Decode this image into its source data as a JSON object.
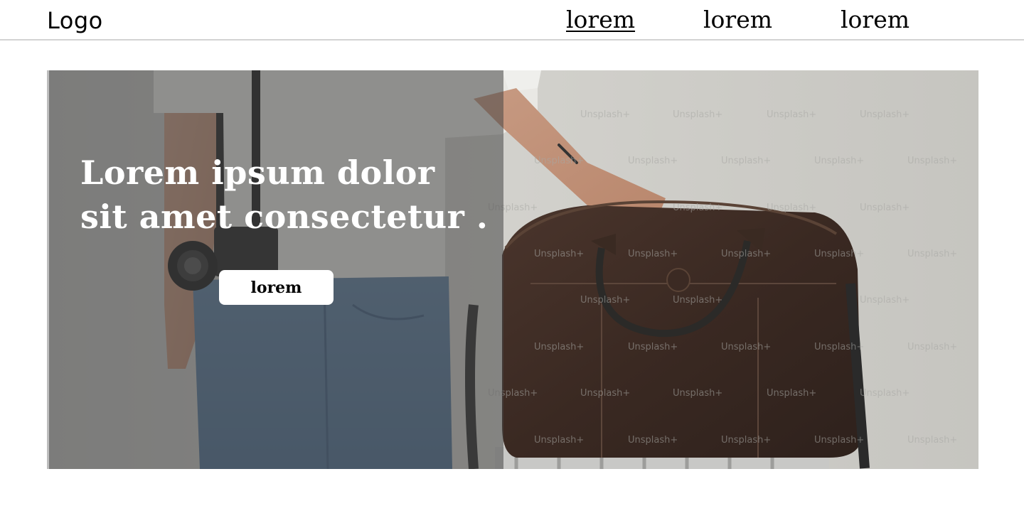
{
  "header": {
    "logo": "Logo",
    "nav": [
      {
        "label": "lorem",
        "active": true
      },
      {
        "label": "lorem",
        "active": false
      },
      {
        "label": "lorem",
        "active": false
      }
    ]
  },
  "hero": {
    "title": "Lorem ipsum dolor sit amet consectetur .",
    "button_label": "lorem",
    "image_description_icon": "photo-person-with-camera-and-leather-bag",
    "watermark_text": "Unsplash+"
  },
  "colors": {
    "background": "#ffffff",
    "text": "#000000",
    "overlay": "#464646",
    "button_bg": "#ffffff",
    "header_border": "#d3d3d3"
  }
}
